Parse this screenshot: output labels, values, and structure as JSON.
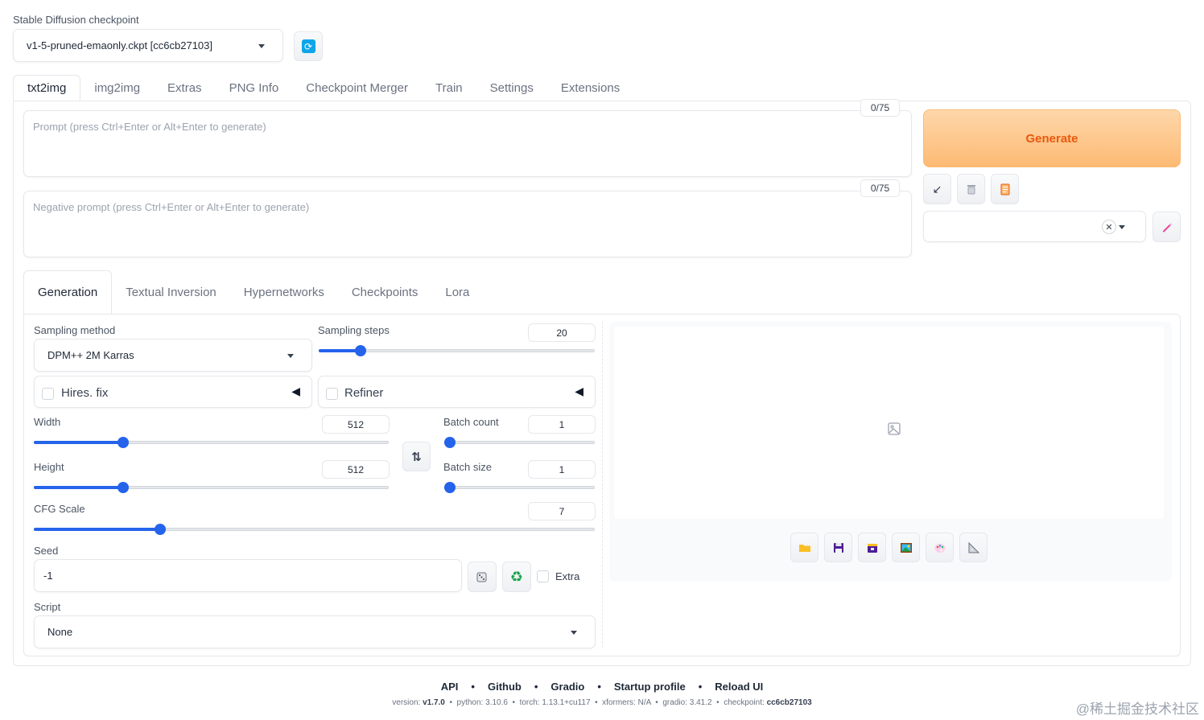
{
  "checkpoint": {
    "label": "Stable Diffusion checkpoint",
    "value": "v1-5-pruned-emaonly.ckpt [cc6cb27103]",
    "refresh_icon": "refresh-icon"
  },
  "main_tabs": [
    "txt2img",
    "img2img",
    "Extras",
    "PNG Info",
    "Checkpoint Merger",
    "Train",
    "Settings",
    "Extensions"
  ],
  "prompt": {
    "placeholder": "Prompt (press Ctrl+Enter or Alt+Enter to generate)",
    "counter": "0/75"
  },
  "negative_prompt": {
    "placeholder": "Negative prompt (press Ctrl+Enter or Alt+Enter to generate)",
    "counter": "0/75"
  },
  "generate": {
    "label": "Generate",
    "color": "#fb923c"
  },
  "tool_icons": [
    "arrow-icon",
    "trash-icon",
    "clipboard-icon"
  ],
  "styles": {
    "clear_glyph": "✕",
    "edit_icon": "pencil-icon"
  },
  "sub_tabs": [
    "Generation",
    "Textual Inversion",
    "Hypernetworks",
    "Checkpoints",
    "Lora"
  ],
  "sampling": {
    "method_label": "Sampling method",
    "method_value": "DPM++ 2M Karras",
    "steps_label": "Sampling steps",
    "steps_value": "20",
    "steps_fraction": 0.13
  },
  "hires": {
    "label": "Hires. fix",
    "arrow": "◀"
  },
  "refiner": {
    "label": "Refiner",
    "arrow": "◀"
  },
  "width": {
    "label": "Width",
    "value": "512",
    "fraction": 0.235
  },
  "height": {
    "label": "Height",
    "value": "512",
    "fraction": 0.235
  },
  "swap_glyph": "⇅",
  "batch_count": {
    "label": "Batch count",
    "value": "1",
    "fraction": 0.0
  },
  "batch_size": {
    "label": "Batch size",
    "value": "1",
    "fraction": 0.0
  },
  "cfg": {
    "label": "CFG Scale",
    "value": "7",
    "fraction": 0.215
  },
  "seed": {
    "label": "Seed",
    "value": "-1",
    "extra_label": "Extra",
    "dice_icon": "dice-icon",
    "recycle_icon": "recycle-icon"
  },
  "script": {
    "label": "Script",
    "value": "None"
  },
  "gallery": {
    "placeholder_icon": "image-icon",
    "action_icons": [
      "folder-icon",
      "save-icon",
      "zip-icon",
      "image-icon",
      "palette-icon",
      "ruler-icon"
    ]
  },
  "footer": {
    "links": [
      "API",
      "Github",
      "Gradio",
      "Startup profile",
      "Reload UI"
    ],
    "separator": "•",
    "versions": [
      {
        "key": "version:",
        "val": "v1.7.0"
      },
      {
        "key": "python:",
        "val": "3.10.6"
      },
      {
        "key": "torch:",
        "val": "1.13.1+cu117"
      },
      {
        "key": "xformers:",
        "val": "N/A"
      },
      {
        "key": "gradio:",
        "val": "3.41.2"
      },
      {
        "key": "checkpoint:",
        "val": "cc6cb27103"
      }
    ]
  },
  "watermark": "@稀土掘金技术社区",
  "colors": {
    "accent": "#2563eb",
    "generate_start": "#fed7aa",
    "generate_end": "#fdba74"
  }
}
